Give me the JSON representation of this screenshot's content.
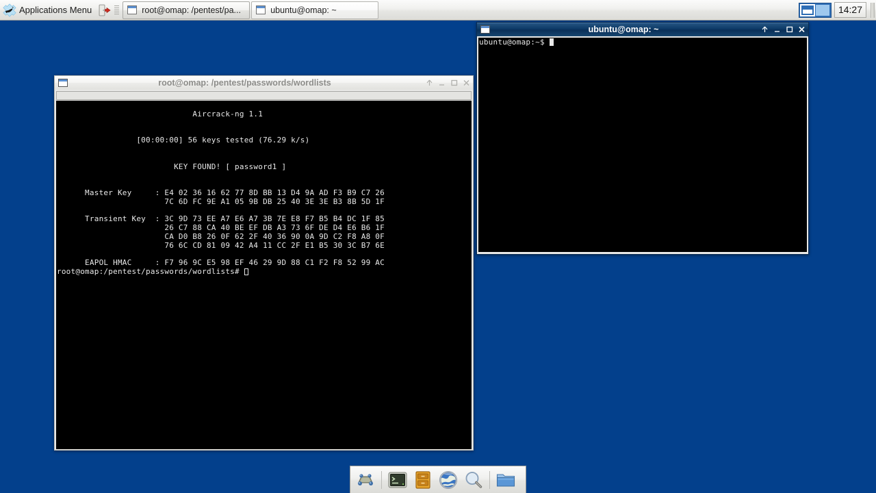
{
  "desktop": {
    "background_color": "#03408c"
  },
  "panel": {
    "applications_menu": {
      "label": "Applications Menu",
      "icon": "xfce-mouse-icon"
    },
    "launchers": [
      {
        "name": "log-out-icon",
        "tooltip": "Log Out"
      }
    ],
    "tasks": [
      {
        "label": "root@omap: /pentest/pa...",
        "active": false,
        "icon": "window-icon"
      },
      {
        "label": "ubuntu@omap: ~",
        "active": true,
        "icon": "window-icon"
      }
    ],
    "workspaces": [
      {
        "name": "workspace-1",
        "active": true
      },
      {
        "name": "workspace-2",
        "active": false
      }
    ],
    "clock": "14:27"
  },
  "windows": [
    {
      "id": "aircrack-window",
      "title": "root@omap: /pentest/passwords/wordlists",
      "active": false,
      "buttons": [
        "shade-icon",
        "minimize-icon",
        "maximize-icon",
        "close-icon"
      ],
      "terminal_lines": [
        "",
        "                             Aircrack-ng 1.1",
        "",
        "",
        "                 [00:00:00] 56 keys tested (76.29 k/s)",
        "",
        "",
        "                         KEY FOUND! [ password1 ]",
        "",
        "",
        "      Master Key     : E4 02 36 16 62 77 8D BB 13 D4 9A AD F3 B9 C7 26",
        "                       7C 6D FC 9E A1 05 9B DB 25 40 3E 3E B3 8B 5D 1F",
        "",
        "      Transient Key  : 3C 9D 73 EE A7 E6 A7 3B 7E E8 F7 B5 B4 DC 1F 85",
        "                       26 C7 88 CA 40 BE EF DB A3 73 6F DE D4 E6 B6 1F",
        "                       CA D0 B8 26 0F 62 2F 40 36 90 0A 9D C2 F8 A8 0F",
        "                       76 6C CD 81 09 42 A4 11 CC 2F E1 B5 30 3C B7 6E",
        "",
        "      EAPOL HMAC     : F7 96 9C E5 98 EF 46 29 9D 88 C1 F2 F8 52 99 AC"
      ],
      "prompt": "root@omap:/pentest/passwords/wordlists# ",
      "cursor": "hollow"
    },
    {
      "id": "ubuntu-window",
      "title": "ubuntu@omap: ~",
      "active": true,
      "buttons": [
        "shade-icon",
        "minimize-icon",
        "maximize-icon",
        "close-icon"
      ],
      "terminal_lines": [],
      "prompt": "ubuntu@omap:~$ ",
      "cursor": "block"
    }
  ],
  "dock": {
    "items": [
      {
        "name": "show-desktop-icon",
        "label": "Show Desktop"
      },
      {
        "name": "terminal-icon",
        "label": "Terminal"
      },
      {
        "name": "file-cabinet-icon",
        "label": "Archive Manager"
      },
      {
        "name": "web-browser-icon",
        "label": "Web Browser"
      },
      {
        "name": "search-icon",
        "label": "Search"
      },
      {
        "name": "file-manager-icon",
        "label": "File Manager"
      }
    ]
  }
}
